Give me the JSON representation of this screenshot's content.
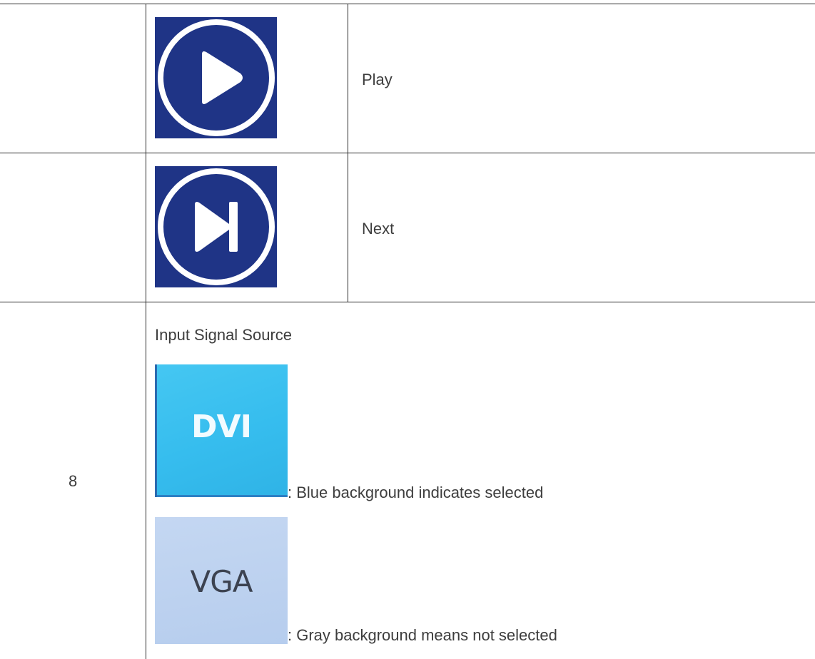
{
  "rows": [
    {
      "number": "",
      "icon": "play-circle-icon",
      "description": "Play"
    },
    {
      "number": "",
      "icon": "next-track-circle-icon",
      "description": "Next"
    }
  ],
  "input_row": {
    "number": "8",
    "title": "Input Signal Source",
    "options": [
      {
        "label": "DVI",
        "note": ":  Blue background indicates selected",
        "bg_color": "#36bdee",
        "state": "selected"
      },
      {
        "label": "VGA",
        "note": ":  Gray background means not selected",
        "bg_color": "#bcd1ef",
        "state": "not selected"
      }
    ]
  },
  "colors": {
    "icon_bg": "#1f3486",
    "icon_fg": "#ffffff",
    "border": "#2b2b2b",
    "text": "#3d3d3d"
  }
}
